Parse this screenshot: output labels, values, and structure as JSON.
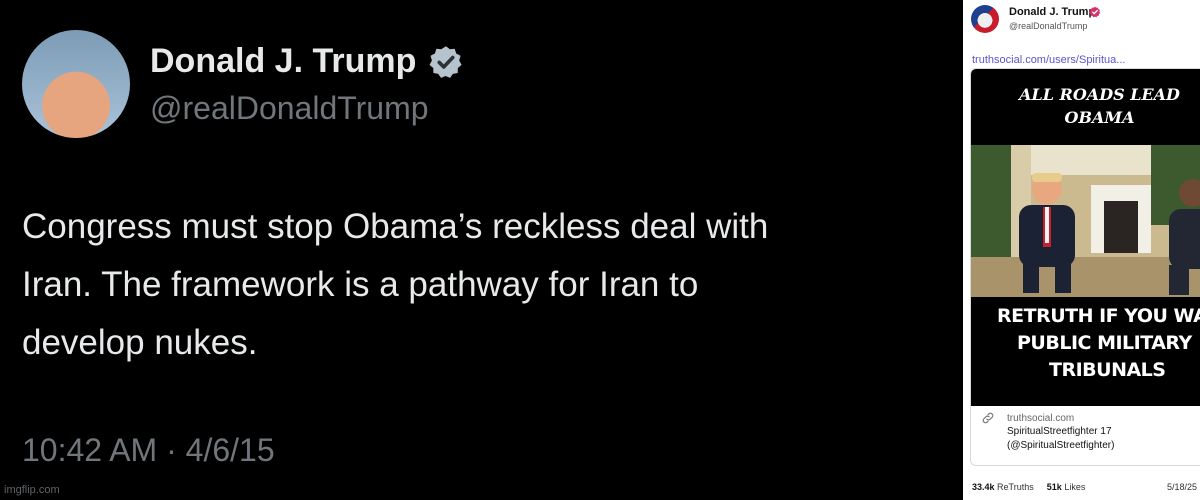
{
  "tweet": {
    "author_name": "Donald J. Trump",
    "handle": "@realDonaldTrump",
    "text_lines": [
      "Congress must stop Obama’s reckless deal with",
      "Iran. The framework is a pathway for Iran to",
      "develop nukes."
    ],
    "timestamp": "10:42 AM · 4/6/15",
    "verified_icon": "verified-badge-icon",
    "watermark": "imgflip.com"
  },
  "truth": {
    "author_name": "Donald J. Trump",
    "handle": "@realDonaldTrump",
    "link_text": "truthsocial.com/users/Spiritua...",
    "meme": {
      "top_line1": "ALL ROADS LEAD",
      "top_line2": "OBAMA",
      "bottom_line1": "RETRUTH IF YOU WAN",
      "bottom_line2": "PUBLIC MILITARY",
      "bottom_line3": "TRIBUNALS"
    },
    "card_source": "truthsocial.com",
    "card_title": "SpiritualStreetfighter 17",
    "card_subtitle": "(@SpiritualStreetfighter)",
    "retruths_count": "33.4k",
    "retruths_label": "ReTruths",
    "likes_count": "51k",
    "likes_label": "Likes",
    "date": "5/18/25",
    "colors": {
      "link": "#5b55c9",
      "verified": "#d6336c"
    }
  }
}
